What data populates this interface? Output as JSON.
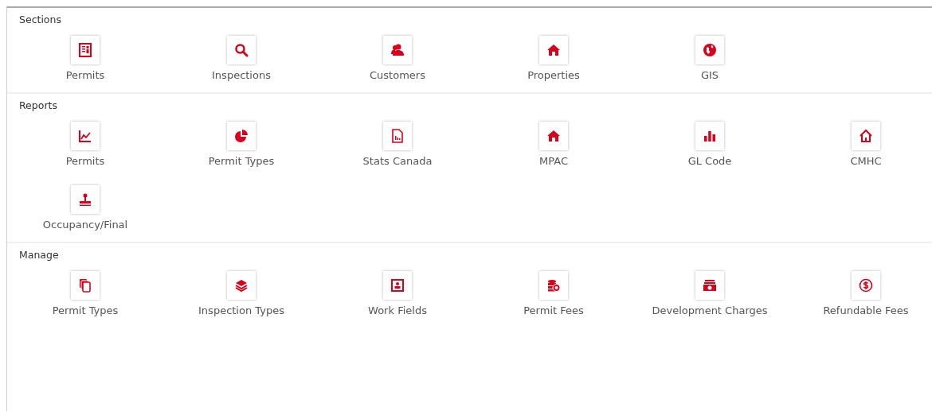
{
  "sections": [
    {
      "title": "Sections",
      "items": [
        {
          "label": "Permits",
          "kind": "document"
        },
        {
          "label": "Inspections",
          "kind": "search"
        },
        {
          "label": "Customers",
          "kind": "users"
        },
        {
          "label": "Properties",
          "kind": "home"
        },
        {
          "label": "GIS",
          "kind": "globe"
        }
      ]
    },
    {
      "title": "Reports",
      "items": [
        {
          "label": "Permits",
          "kind": "line-chart"
        },
        {
          "label": "Permit Types",
          "kind": "pie"
        },
        {
          "label": "Stats Canada",
          "kind": "file-chart"
        },
        {
          "label": "MPAC",
          "kind": "home"
        },
        {
          "label": "GL Code",
          "kind": "bar-chart"
        },
        {
          "label": "CMHC",
          "kind": "home-outline"
        },
        {
          "label": "Occupancy/Final",
          "kind": "stamp"
        }
      ]
    },
    {
      "title": "Manage",
      "items": [
        {
          "label": "Permit Types",
          "kind": "copies"
        },
        {
          "label": "Inspection Types",
          "kind": "layers"
        },
        {
          "label": "Work Fields",
          "kind": "id-card"
        },
        {
          "label": "Permit Fees",
          "kind": "coins"
        },
        {
          "label": "Development Charges",
          "kind": "money"
        },
        {
          "label": "Refundable Fees",
          "kind": "dollar-circle"
        }
      ]
    }
  ]
}
